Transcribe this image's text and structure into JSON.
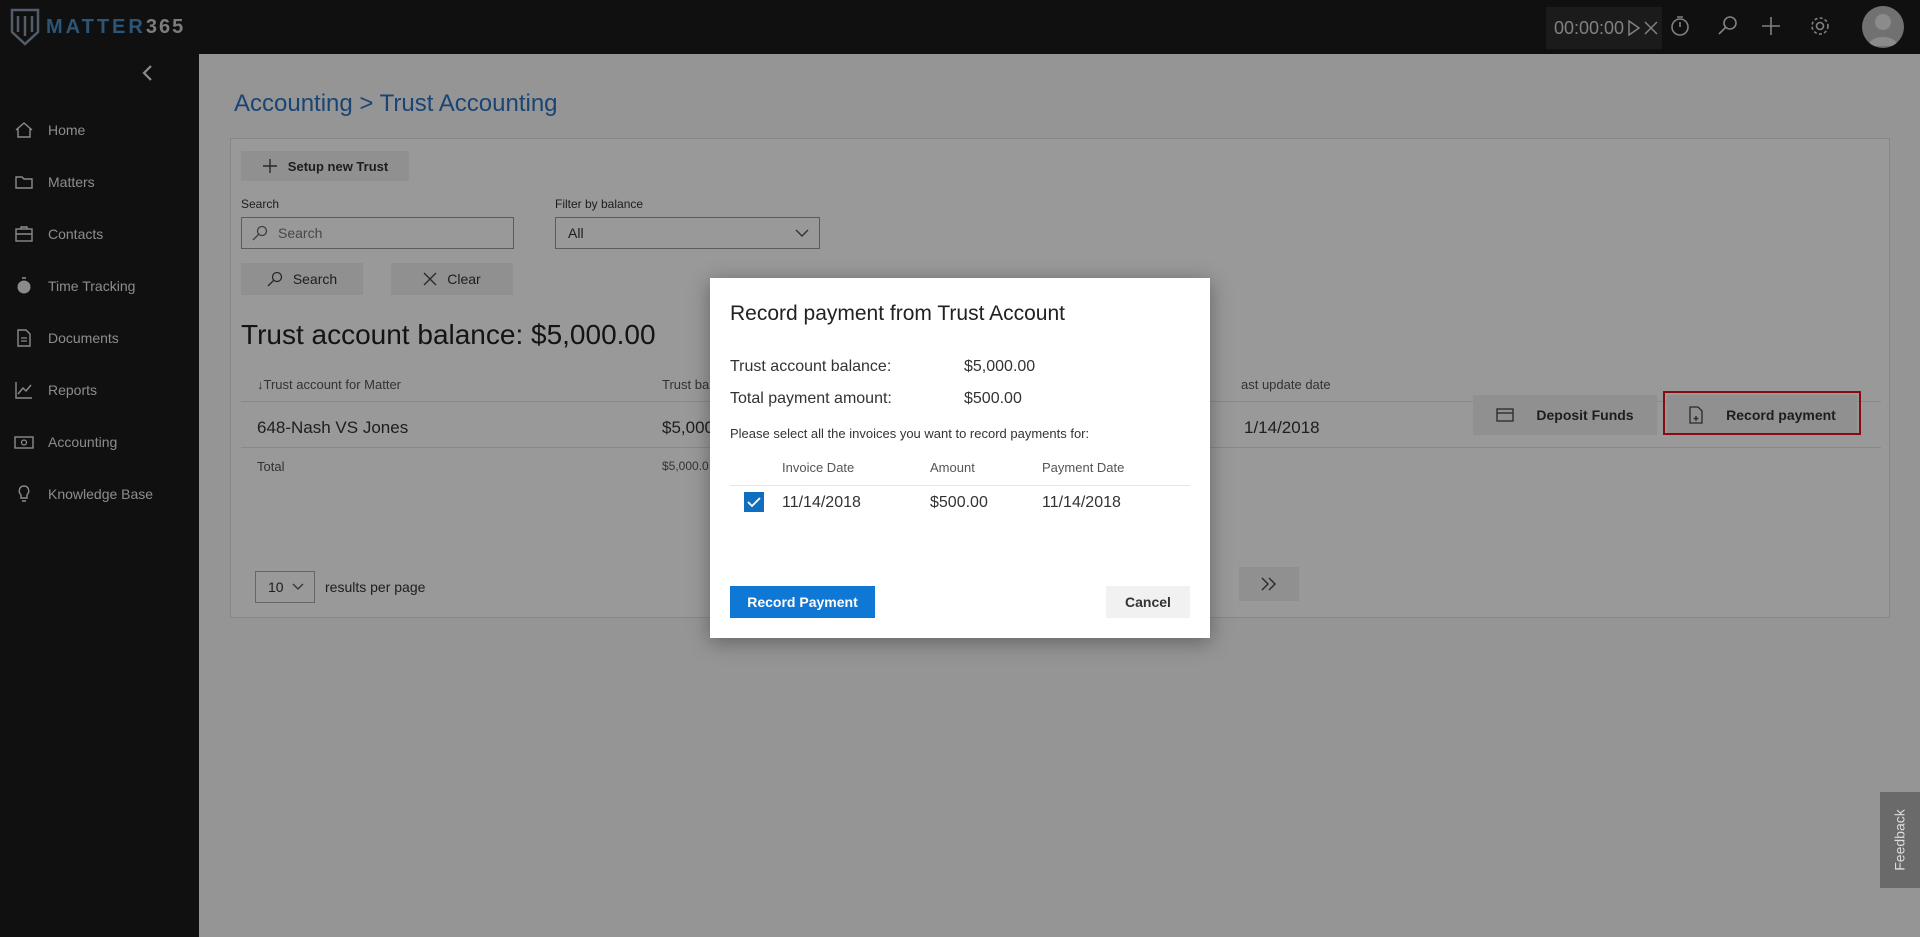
{
  "app": {
    "logo_text_a": "MATTER",
    "logo_text_b": "365",
    "timer": "00:00:00"
  },
  "sidebar": {
    "items": [
      {
        "label": "Home",
        "icon": "home-icon"
      },
      {
        "label": "Matters",
        "icon": "folder-icon"
      },
      {
        "label": "Contacts",
        "icon": "contacts-icon"
      },
      {
        "label": "Time Tracking",
        "icon": "stopwatch-icon"
      },
      {
        "label": "Documents",
        "icon": "documents-icon"
      },
      {
        "label": "Reports",
        "icon": "chart-icon"
      },
      {
        "label": "Accounting",
        "icon": "money-icon"
      },
      {
        "label": "Knowledge Base",
        "icon": "lightbulb-icon"
      }
    ]
  },
  "main": {
    "breadcrumb": "Accounting > Trust Accounting",
    "setup_button": "Setup new Trust",
    "search_label": "Search",
    "search_placeholder": "Search",
    "filter_label": "Filter by balance",
    "filter_value": "All",
    "search_button": "Search",
    "clear_button": "Clear",
    "balance_title": "Trust account balance: $5,000.00",
    "table": {
      "headers": [
        "Trust account for Matter",
        "Trust ba",
        "ast update date"
      ],
      "row": {
        "matter": "648-Nash VS Jones",
        "balance": "$5,000",
        "last_update": "1/14/2018"
      },
      "total_label": "Total",
      "total_value": "$5,000.0"
    },
    "deposit_button": "Deposit Funds",
    "record_button": "Record payment",
    "per_page_value": "10",
    "per_page_label": "results per page"
  },
  "dialog": {
    "title": "Record payment from Trust Account",
    "balance_label": "Trust account balance:",
    "balance_value": "$5,000.00",
    "total_label": "Total payment amount:",
    "total_value": "$500.00",
    "instruction": "Please select all the invoices you want to record payments for:",
    "headers": [
      "Invoice Date",
      "Amount",
      "Payment Date"
    ],
    "row": {
      "invoice_date": "11/14/2018",
      "amount": "$500.00",
      "payment_date": "11/14/2018",
      "checked": true
    },
    "primary_button": "Record Payment",
    "cancel_button": "Cancel"
  },
  "feedback": "Feedback",
  "colors": {
    "accent": "#0f78d4",
    "highlight": "#e1141d",
    "topbar": "#1b1b1b"
  }
}
